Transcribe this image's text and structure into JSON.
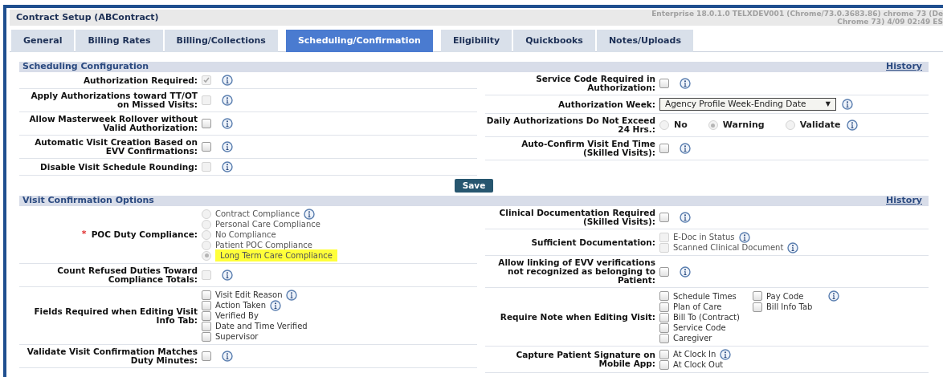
{
  "window": {
    "title": "Contract Setup (ABContract)",
    "version_lines": [
      "Enterprise 18.0.1.0 TELXDEV001 (Chrome/73.0.3683.86) chrome 73 (De",
      "Chrome 73) 4/09 02:49 ES"
    ]
  },
  "tabs": [
    {
      "label": "General",
      "selected": false
    },
    {
      "label": "Billing Rates",
      "selected": false
    },
    {
      "label": "Billing/Collections",
      "selected": false
    },
    {
      "label": "Scheduling/Confirmation",
      "selected": true
    },
    {
      "label": "Eligibility",
      "selected": false
    },
    {
      "label": "Quickbooks",
      "selected": false
    },
    {
      "label": "Notes/Uploads",
      "selected": false
    }
  ],
  "sections": [
    {
      "title": "Scheduling Configuration",
      "history": "History",
      "left": [
        {
          "kind": "checkbox",
          "label": "Authorization Required:",
          "checked": true,
          "disabled": true,
          "info": true
        },
        {
          "kind": "checkbox",
          "label": "Apply Authorizations toward TT/OT on Missed Visits:",
          "checked": false,
          "disabled": true,
          "info": true
        },
        {
          "kind": "checkbox",
          "label": "Allow Masterweek Rollover without Valid Authorization:",
          "checked": false,
          "disabled": false,
          "info": true
        },
        {
          "kind": "checkbox",
          "label": "Automatic Visit Creation Based on EVV Confirmations:",
          "checked": false,
          "disabled": false,
          "info": true
        },
        {
          "kind": "checkbox",
          "label": "Disable Visit Schedule Rounding:",
          "checked": false,
          "disabled": true,
          "info": true
        }
      ],
      "right": [
        {
          "kind": "checkbox",
          "label": "Service Code Required in Authorization:",
          "checked": false,
          "disabled": false,
          "info": true
        },
        {
          "kind": "select",
          "label": "Authorization Week:",
          "value": "Agency Profile Week-Ending Date",
          "arrow": "▼",
          "info": true
        },
        {
          "kind": "radio_inline",
          "label": "Daily Authorizations Do Not Exceed 24 Hrs.:",
          "info": true,
          "options": [
            {
              "label": "No",
              "selected": false
            },
            {
              "label": "Warning",
              "selected": true
            },
            {
              "label": "Validate",
              "selected": false
            }
          ]
        },
        {
          "kind": "checkbox",
          "label": "Auto-Confirm Visit End Time (Skilled Visits):",
          "checked": false,
          "disabled": false,
          "info": true
        }
      ],
      "button": "Save"
    },
    {
      "title": "Visit Confirmation Options",
      "history": "History",
      "left": [
        {
          "kind": "radio_list",
          "label": "POC Duty Compliance:",
          "required_mark": "*",
          "disabled": true,
          "options": [
            {
              "label": "Contract Compliance",
              "selected": false,
              "info": true,
              "highlighted": false
            },
            {
              "label": "Personal Care Compliance",
              "selected": false,
              "info": false,
              "highlighted": false
            },
            {
              "label": "No Compliance",
              "selected": false,
              "info": false,
              "highlighted": false
            },
            {
              "label": "Patient POC Compliance",
              "selected": false,
              "info": false,
              "highlighted": false
            },
            {
              "label": "Long Term Care Compliance",
              "selected": true,
              "info": false,
              "highlighted": true
            }
          ]
        },
        {
          "kind": "checkbox",
          "label": "Count Refused Duties Toward Compliance Totals:",
          "checked": false,
          "disabled": true,
          "info": true
        },
        {
          "kind": "checkbox_list",
          "label": "Fields Required when Editing Visit Info Tab:",
          "disabled": false,
          "options": [
            {
              "label": "Visit Edit Reason",
              "selected": false,
              "info": true
            },
            {
              "label": "Action Taken",
              "selected": false,
              "info": true
            },
            {
              "label": "Verified By",
              "selected": false,
              "info": false
            },
            {
              "label": "Date and Time Verified",
              "selected": false,
              "info": false
            },
            {
              "label": "Supervisor",
              "selected": false,
              "info": false
            }
          ]
        },
        {
          "kind": "checkbox",
          "label": "Validate Visit Confirmation Matches Duty Minutes:",
          "checked": false,
          "disabled": false,
          "info": true
        }
      ],
      "right": [
        {
          "kind": "checkbox",
          "label": "Clinical Documentation Required (Skilled Visits):",
          "checked": false,
          "disabled": false,
          "info": true
        },
        {
          "kind": "checkbox_list",
          "label": "Sufficient Documentation:",
          "disabled": true,
          "options": [
            {
              "label": "E-Doc in Status",
              "selected": false,
              "info": true
            },
            {
              "label": "Scanned Clinical Document",
              "selected": false,
              "info": true
            }
          ]
        },
        {
          "kind": "checkbox",
          "label": "Allow linking of EVV verifications not recognized as belonging to Patient:",
          "checked": false,
          "disabled": false,
          "info": true
        },
        {
          "kind": "option_grid",
          "label": "Require Note when Editing Visit:",
          "info": true,
          "rows": [
            [
              {
                "label": "Schedule Times",
                "selected": false
              },
              {
                "label": "Pay Code",
                "selected": false
              }
            ],
            [
              {
                "label": "Plan of Care",
                "selected": false
              },
              {
                "label": "Bill Info Tab",
                "selected": false
              }
            ],
            [
              {
                "label": "Bill To (Contract)",
                "selected": false
              }
            ],
            [
              {
                "label": "Service Code",
                "selected": false
              }
            ],
            [
              {
                "label": "Caregiver",
                "selected": false
              }
            ]
          ]
        },
        {
          "kind": "checkbox_list",
          "label": "Capture Patient Signature on Mobile App:",
          "disabled": false,
          "options": [
            {
              "label": "At Clock In",
              "selected": false,
              "info": true
            },
            {
              "label": "At Clock Out",
              "selected": false,
              "info": false
            }
          ]
        }
      ]
    }
  ]
}
